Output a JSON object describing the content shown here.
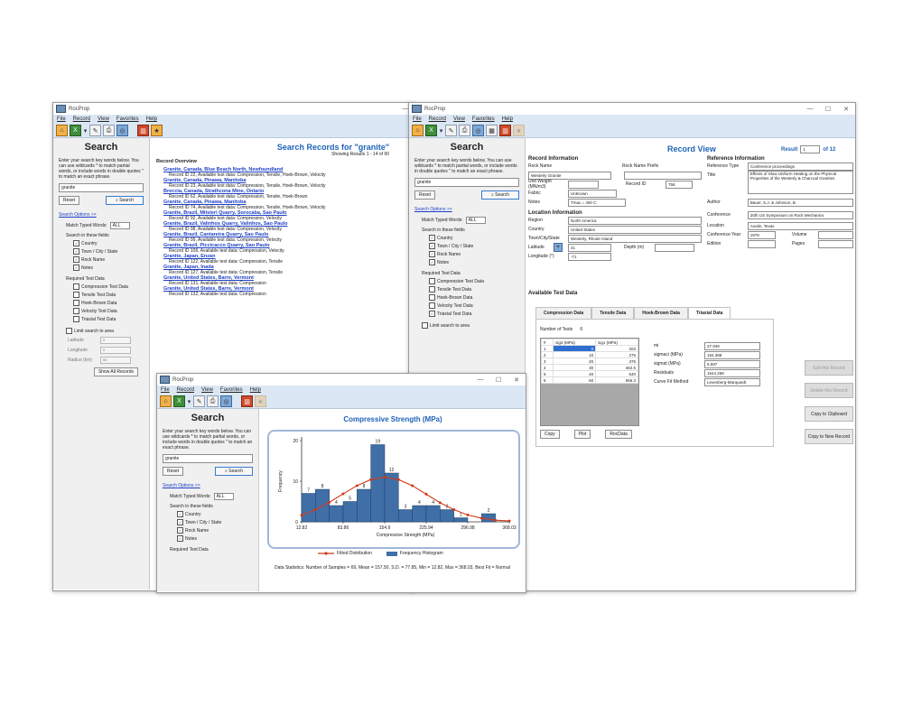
{
  "app_title": "RocProp",
  "menu": [
    "File",
    "Record",
    "View",
    "Favorites",
    "Help"
  ],
  "search": {
    "title": "Search",
    "help": "Enter your search key words below. You can use wildcards * to match partial words, or include words in double quotes \" to match an exact phrase.",
    "query": "granite",
    "reset_label": "Reset",
    "search_label": "Search",
    "options_link": "Search Options  >>",
    "match_label": "Match Typed Words:",
    "match_value": "ALL",
    "fields_label": "Search in these fields",
    "fields": [
      {
        "label": "Country",
        "checked": true
      },
      {
        "label": "Town / City / State",
        "checked": true
      },
      {
        "label": "Rock Name",
        "checked": true
      },
      {
        "label": "Notes",
        "checked": true
      }
    ],
    "required_label": "Required Test Data",
    "required": [
      "Compression Test Data",
      "Tensile Test Data",
      "Hoek-Brown Data",
      "Velocity Test Data",
      "Triaxial Test Data"
    ],
    "required_checked_win2": [
      "Triaxial Test Data"
    ],
    "limit_label": "Limit search to area",
    "latitude_label": "Latitude",
    "longitude_label": "Longitude",
    "radius_label": "Radius (km)",
    "latitude_value": "0",
    "longitude_value": "0",
    "radius_value": "50",
    "show_all_label": "Show All Records",
    "check_mark": "✓"
  },
  "results": {
    "title": "Search Records for \"granite\"",
    "subtitle": "Showing Results 1 - 14  of  90",
    "overview_label": "Record Overview",
    "records": [
      {
        "name": "Granite, Canada, Blue Beach North, Newfoundland",
        "info": "Record ID 22,  Available test data: Compression, Tensile, Hoek-Brown, Velocity"
      },
      {
        "name": "Granite, Canada, Pinawa, Manitoba",
        "info": "Record ID 23,  Available test data: Compression, Tensile, Hoek-Brown, Velocity"
      },
      {
        "name": "Breccia, Canada, Strathcona Mine, Ontario",
        "info": "Record ID 62,  Available test data: Compression, Tensile, Hoek-Brown"
      },
      {
        "name": "Granite, Canada, Pinawa, Manitoba",
        "info": "Record ID 74,  Available test data: Compression, Tensile, Hoek-Brown, Velocity"
      },
      {
        "name": "Granite, Brazil, Mitsleri Quarry, Sorocaba, Sao Paulo",
        "info": "Record ID 92,  Available test data: Compression, Velocity"
      },
      {
        "name": "Granite, Brazil, Valinhos Quarry, Valinhos, Sao Paulo",
        "info": "Record ID 98,  Available test data: Compression, Velocity"
      },
      {
        "name": "Granite, Brazil, Cantareira Quarry, Sao Paulo",
        "info": "Record ID 99,  Available test data: Compression, Velocity"
      },
      {
        "name": "Granite, Brazil, Piccicacco Quarry, Sao Paulo",
        "info": "Record ID 106,  Available test data: Compression, Velocity"
      },
      {
        "name": "Granite, Japan, Enzan",
        "info": "Record ID 122,  Available test data: Compression, Tensile"
      },
      {
        "name": "Granite, Japan, Inada",
        "info": "Record ID 127,  Available test data: Compression, Tensile"
      },
      {
        "name": "Granite, United States, Barre, Vermont",
        "info": "Record ID 131,  Available test data: Compression"
      },
      {
        "name": "Granite, United States, Barre, Vermont",
        "info": "Record ID 132,  Available test data: Compression"
      }
    ]
  },
  "record_view": {
    "title": "Record View",
    "result_label": "Result",
    "result_value": "1",
    "result_of": "of 12",
    "record_info_label": "Record Information",
    "rock_name_label": "Rock Name",
    "rock_name_value": "Westerly Granite",
    "prefix_label": "Rock Name Prefix",
    "unit_weight_label": "Unit Weight (MN/m3)",
    "record_id_label": "Record ID",
    "record_id_value": "758",
    "fabric_label": "Fabric",
    "fabric_value": "Unknown",
    "notes_label": "Notes",
    "notes_value": "Tmax = 400 C",
    "location_label": "Location Information",
    "region_label": "Region",
    "region_value": "North America",
    "country_label": "Country",
    "country_value": "United States",
    "town_label": "Town/City/State",
    "town_value": "Westerly, Rhode Island",
    "latitude_label": "Latitude",
    "latitude_value": "41",
    "depth_label": "Depth (m)",
    "longitude_label": "Longitude (°)",
    "longitude_value": "-71",
    "ref_label": "Reference Information",
    "ref_type_label": "Reference Type",
    "ref_type_value": "Conference proceedings",
    "title_label": "Title",
    "title_value": "Effects of Slow Uniform Heating on the Physical Properties of the Westerly & Charcoal Granites",
    "author_label": "Author",
    "author_value": "Bauer, S.J. & Johnson, B.",
    "conference_label": "Conference",
    "conference_value": "20th US Symposium on Rock Mechanics",
    "location2_label": "Location",
    "location2_value": "Austin, Texas",
    "conf_year_label": "Conference Year",
    "conf_year_value": "1979",
    "volume_label": "Volume",
    "edition_label": "Edition",
    "pages_label": "Pages",
    "available_label": "Available Test Data",
    "tabs": [
      "Compression Data",
      "Tensile Data",
      "Hoek-Brown Data",
      "Triaxial Data"
    ],
    "num_tests_label": "Number of Tests",
    "num_tests_value": "6",
    "grid_headers": [
      "#",
      "sig3 (MPa)",
      "sig1 (MPa)"
    ],
    "grid_rows": [
      [
        "1",
        "0",
        "203"
      ],
      [
        "2",
        "10",
        "275"
      ],
      [
        "3",
        "20",
        "375"
      ],
      [
        "4",
        "30",
        "462.5"
      ],
      [
        "5",
        "40",
        "540"
      ],
      [
        "6",
        "60",
        "656.3"
      ]
    ],
    "params": [
      {
        "label": "mi",
        "value": "27.949"
      },
      {
        "label": "sigmaci (MPa)",
        "value": "184.388"
      },
      {
        "label": "sigmat (MPa)",
        "value": "6.597"
      },
      {
        "label": "Residuals",
        "value": "1544.258"
      },
      {
        "label": "Curve Fit Method",
        "value": "Levenberg-Marquardt"
      }
    ],
    "copy_label": "Copy",
    "plot_label": "Plot",
    "rocdata_label": "RocData",
    "side_buttons": [
      "Edit this Record",
      "Delete this Record",
      "Copy to Clipboard",
      "Copy to New Record"
    ]
  },
  "chart_data": {
    "type": "bar",
    "title": "Compressive Strength (MPa)",
    "xlabel": "Compressive Strength (MPa)",
    "ylabel": "Frequency",
    "xlim": [
      12.82,
      368.03
    ],
    "ylim": [
      0,
      20
    ],
    "x_ticks": [
      "12.82",
      "83.86",
      "154.9",
      "225.94",
      "296.98",
      "368.03"
    ],
    "y_ticks": [
      "0",
      "10",
      "20"
    ],
    "bar_width": 23.68,
    "bars": [
      {
        "x": 24.66,
        "value": 7
      },
      {
        "x": 48.34,
        "value": 8
      },
      {
        "x": 72.02,
        "value": 4
      },
      {
        "x": 95.7,
        "value": 5
      },
      {
        "x": 119.38,
        "value": 8
      },
      {
        "x": 143.06,
        "value": 19
      },
      {
        "x": 166.74,
        "value": 12
      },
      {
        "x": 190.42,
        "value": 3
      },
      {
        "x": 214.1,
        "value": 4
      },
      {
        "x": 237.78,
        "value": 4
      },
      {
        "x": 261.46,
        "value": 3
      },
      {
        "x": 285.14,
        "value": 1
      },
      {
        "x": 308.82,
        "value": 0
      },
      {
        "x": 332.5,
        "value": 2
      }
    ],
    "bar_labels": [
      "7",
      "8",
      "4",
      "5",
      "8",
      "19",
      "12",
      "3",
      "4",
      "4",
      "3",
      "1",
      "",
      "2"
    ],
    "fit": [
      [
        12.82,
        1.6
      ],
      [
        36.5,
        3.0
      ],
      [
        60.2,
        4.8
      ],
      [
        83.86,
        6.9
      ],
      [
        107.5,
        8.9
      ],
      [
        131.2,
        10.4
      ],
      [
        154.9,
        11.0
      ],
      [
        178.6,
        10.4
      ],
      [
        202.3,
        8.9
      ],
      [
        225.94,
        6.8
      ],
      [
        249.6,
        4.7
      ],
      [
        273.3,
        3.0
      ],
      [
        296.98,
        1.7
      ],
      [
        320.7,
        0.9
      ],
      [
        344.3,
        0.4
      ],
      [
        368.03,
        0.2
      ]
    ],
    "legend": [
      "Fitted Distribution",
      "Frequency Histogram"
    ],
    "legend_position": "bottom",
    "colors": {
      "bar": "#3f6fa6",
      "fit": "#d03a1a"
    },
    "stats": "Data Statistics:  Number of Samples = 69,   Mean = 157.50,   S.D. = 77.85,   Min = 12.82,   Max = 368.03,   Best Fit = Normal"
  }
}
